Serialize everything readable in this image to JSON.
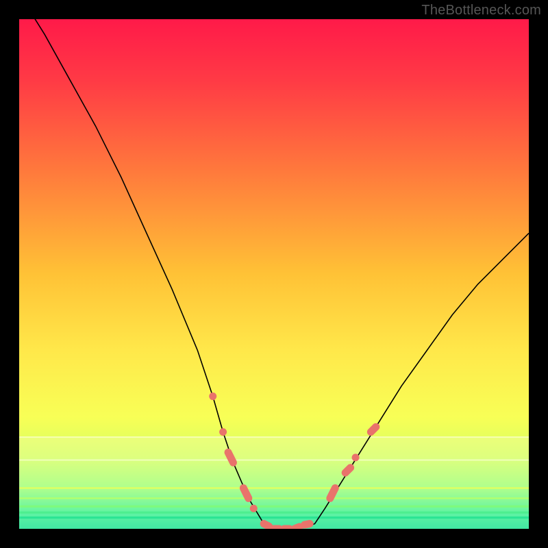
{
  "watermark": "TheBottleneck.com",
  "chart_data": {
    "type": "line",
    "title": "",
    "xlabel": "",
    "ylabel": "",
    "xlim": [
      0,
      100
    ],
    "ylim": [
      0,
      100
    ],
    "grid": false,
    "legend": false,
    "series": [
      {
        "name": "bottleneck-curve",
        "x": [
          0,
          5,
          10,
          15,
          20,
          25,
          30,
          35,
          38,
          40,
          42,
          45,
          48,
          50,
          52,
          55,
          58,
          60,
          65,
          70,
          75,
          80,
          85,
          90,
          95,
          100
        ],
        "y": [
          105,
          97,
          88,
          79,
          69,
          58,
          47,
          35,
          26,
          19,
          13,
          6,
          1,
          0,
          0,
          0,
          1,
          4,
          12,
          20,
          28,
          35,
          42,
          48,
          53,
          58
        ]
      }
    ],
    "threshold_band_y": [
      0,
      18
    ],
    "markers": {
      "name": "highlighted-points",
      "color": "#e9736b",
      "points": [
        {
          "x": 38,
          "y": 26
        },
        {
          "x": 40,
          "y": 19
        },
        {
          "x": 41,
          "y": 15
        },
        {
          "x": 42,
          "y": 13
        },
        {
          "x": 44,
          "y": 8
        },
        {
          "x": 45,
          "y": 6
        },
        {
          "x": 46,
          "y": 4
        },
        {
          "x": 48,
          "y": 1
        },
        {
          "x": 49,
          "y": 0.5
        },
        {
          "x": 50,
          "y": 0
        },
        {
          "x": 51,
          "y": 0
        },
        {
          "x": 52,
          "y": 0
        },
        {
          "x": 53,
          "y": 0
        },
        {
          "x": 54,
          "y": 0
        },
        {
          "x": 55,
          "y": 0.4
        },
        {
          "x": 56,
          "y": 0.8
        },
        {
          "x": 57,
          "y": 1
        },
        {
          "x": 61,
          "y": 6
        },
        {
          "x": 62,
          "y": 8
        },
        {
          "x": 64,
          "y": 11
        },
        {
          "x": 65,
          "y": 12
        },
        {
          "x": 66,
          "y": 14
        },
        {
          "x": 69,
          "y": 19
        },
        {
          "x": 70,
          "y": 20
        }
      ]
    },
    "gradient_stops": [
      {
        "pos": 0.0,
        "color": "#ff1a49"
      },
      {
        "pos": 0.12,
        "color": "#ff3a45"
      },
      {
        "pos": 0.3,
        "color": "#ff7a3c"
      },
      {
        "pos": 0.5,
        "color": "#ffc236"
      },
      {
        "pos": 0.65,
        "color": "#ffe84a"
      },
      {
        "pos": 0.78,
        "color": "#f8ff56"
      },
      {
        "pos": 0.86,
        "color": "#d7ff62"
      },
      {
        "pos": 0.92,
        "color": "#9dff74"
      },
      {
        "pos": 0.97,
        "color": "#3cf18f"
      },
      {
        "pos": 1.0,
        "color": "#18e28f"
      }
    ]
  }
}
